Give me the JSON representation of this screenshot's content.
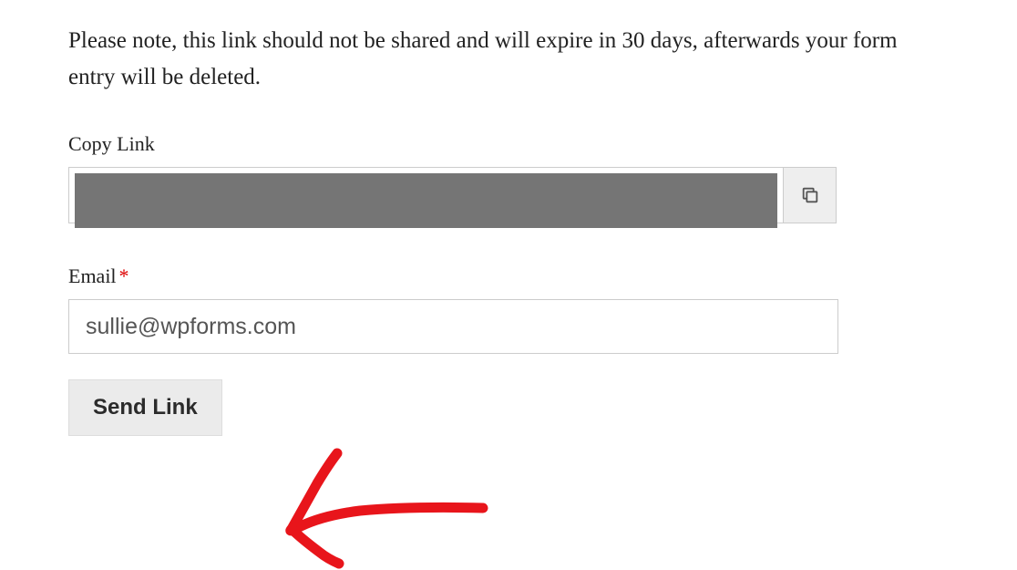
{
  "description": "Please note, this link should not be shared and will expire in 30 days, afterwards your form entry will be deleted.",
  "copyLink": {
    "label": "Copy Link",
    "value": ""
  },
  "email": {
    "label": "Email",
    "required": "*",
    "value": "sullie@wpforms.com"
  },
  "sendButton": {
    "label": "Send Link"
  }
}
